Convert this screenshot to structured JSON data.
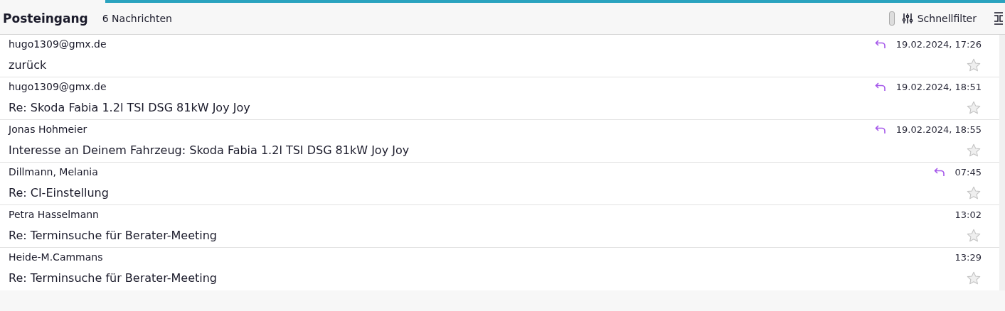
{
  "header": {
    "title": "Posteingang",
    "count": "6 Nachrichten",
    "quick_filter": {
      "label": "Schnellfilter"
    }
  },
  "messages": [
    {
      "sender": "hugo1309@gmx.de",
      "subject": "zurück",
      "date": "19.02.2024, 17:26",
      "replied": true,
      "starred": false
    },
    {
      "sender": "hugo1309@gmx.de",
      "subject": "Re: Skoda Fabia 1.2l TSI DSG 81kW Joy Joy",
      "date": "19.02.2024, 18:51",
      "replied": true,
      "starred": false
    },
    {
      "sender": "Jonas Hohmeier",
      "subject": "Interesse an Deinem Fahrzeug: Skoda Fabia 1.2l TSI DSG 81kW Joy Joy",
      "date": "19.02.2024, 18:55",
      "replied": true,
      "starred": false
    },
    {
      "sender": "Dillmann, Melania",
      "subject": "Re: CI-Einstellung",
      "date": "07:45",
      "replied": true,
      "starred": false
    },
    {
      "sender": "Petra Hasselmann",
      "subject": "Re: Terminsuche für Berater-Meeting",
      "date": "13:02",
      "replied": false,
      "starred": false
    },
    {
      "sender": "Heide-M.Cammans",
      "subject": "Re: Terminsuche für Berater-Meeting",
      "date": "13:29",
      "replied": false,
      "starred": false
    }
  ]
}
